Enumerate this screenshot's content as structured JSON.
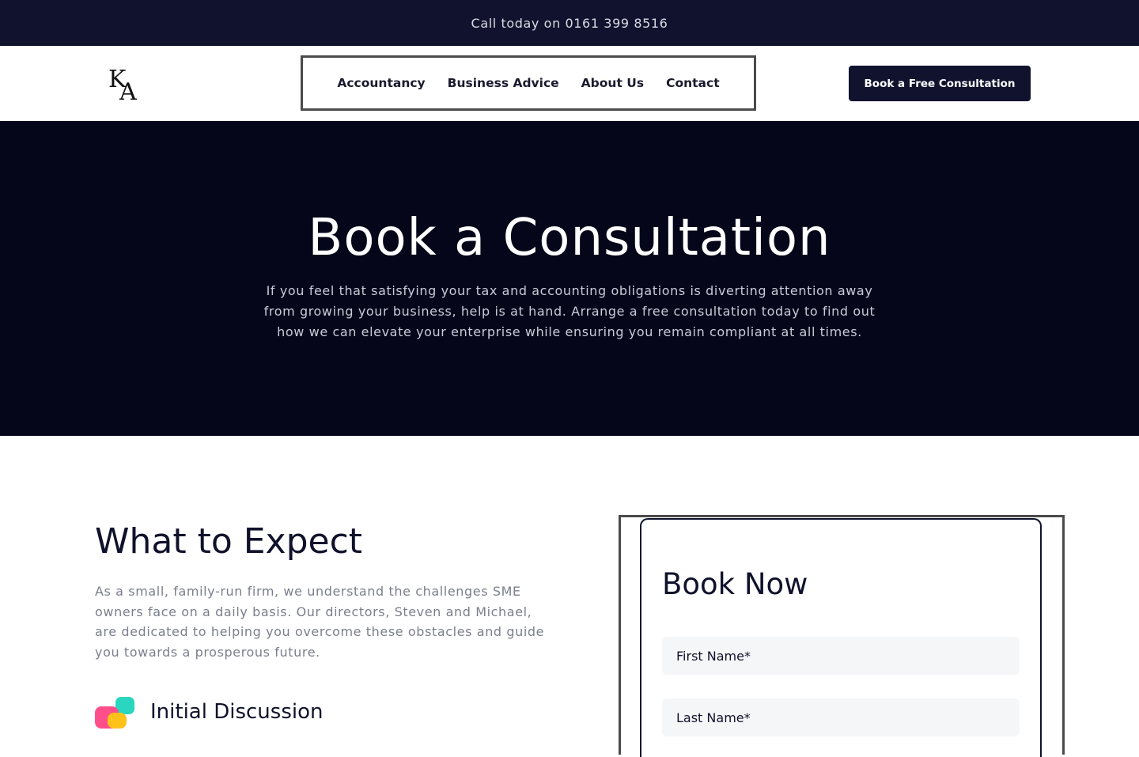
{
  "topbar": {
    "text": "Call today on 0161 399 8516"
  },
  "header": {
    "logo_text": "KA",
    "nav": [
      {
        "label": "Accountancy"
      },
      {
        "label": "Business Advice"
      },
      {
        "label": "About Us"
      },
      {
        "label": "Contact"
      }
    ],
    "cta_label": "Book a Free Consultation"
  },
  "hero": {
    "title": "Book a Consultation",
    "body": "If you feel that satisfying your tax and accounting obligations is diverting attention away from growing your business, help is at hand. Arrange a free consultation today to find out how we can elevate your enterprise while ensuring you remain compliant at all times."
  },
  "expect": {
    "title": "What to Expect",
    "body": "As a small, family-run firm, we understand the challenges SME owners face on a daily basis. Our directors, Steven and Michael, are dedicated to helping you overcome these obstacles and guide you towards a prosperous future.",
    "step_title": "Initial Discussion"
  },
  "form": {
    "title": "Book Now",
    "first_name_placeholder": "First Name*",
    "last_name_placeholder": "Last Name*"
  },
  "colors": {
    "navy": "#11132e",
    "hero_bg": "#06061a",
    "icon_pink": "#ff4f8b",
    "icon_teal": "#2ad6c0",
    "icon_yellow": "#ffc21a"
  }
}
